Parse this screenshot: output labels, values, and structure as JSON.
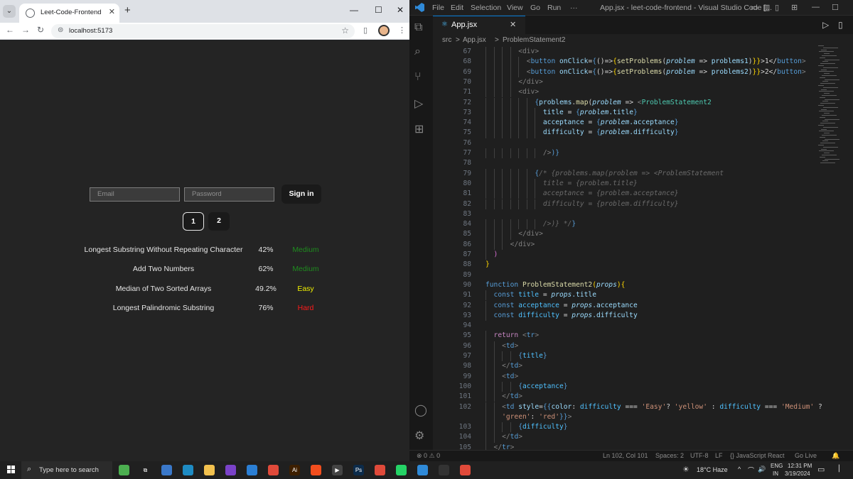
{
  "browser": {
    "tab_title": "Leet-Code-Frontend",
    "url": "localhost:5173",
    "new_tab": "+",
    "close_tab": "✕"
  },
  "webpage": {
    "email_placeholder": "Email",
    "password_placeholder": "Password",
    "signin_label": "Sign in",
    "page_buttons": [
      "1",
      "2"
    ],
    "problems": [
      {
        "title": "Longest Substring Without Repeating Character",
        "acceptance": "42%",
        "difficulty": "Medium",
        "color": "#1f8b1f"
      },
      {
        "title": "Add Two Numbers",
        "acceptance": "62%",
        "difficulty": "Medium",
        "color": "#1f8b1f"
      },
      {
        "title": "Median of Two Sorted Arrays",
        "acceptance": "49.2%",
        "difficulty": "Easy",
        "color": "#f0f000"
      },
      {
        "title": "Longest Palindromic Substring",
        "acceptance": "76%",
        "difficulty": "Hard",
        "color": "#ff1a1a"
      }
    ]
  },
  "vscode": {
    "menu": [
      "File",
      "Edit",
      "Selection",
      "View",
      "Go",
      "Run",
      "···"
    ],
    "window_title": "App.jsx - leet-code-frontend - Visual Studio Code [...",
    "tab_name": "App.jsx",
    "breadcrumb": [
      "src",
      ">",
      "App.jsx",
      ">",
      "ProblemStatement2"
    ],
    "status": {
      "problems": "⊗ 0 ⚠ 0",
      "cursor": "Ln 102, Col 101",
      "spaces": "Spaces: 2",
      "encoding": "UTF-8",
      "eol": "LF",
      "language": "{} JavaScript React",
      "golive": "Go Live"
    },
    "code_lines": [
      {
        "n": "67",
        "i": 4,
        "t": [
          [
            "<div>",
            "#808080"
          ]
        ]
      },
      {
        "n": "68",
        "i": 5,
        "t": [
          [
            "<",
            "#808080"
          ],
          [
            "button ",
            "#569cd6"
          ],
          [
            "onClick",
            "#9cdcfe"
          ],
          [
            "=",
            "#d4d4d4"
          ],
          [
            "{",
            "#569cd6"
          ],
          [
            "()=>",
            "#d4d4d4"
          ],
          [
            "{",
            "#ffd700"
          ],
          [
            "setProblems",
            "#dcdcaa"
          ],
          [
            "(",
            "#d4d4d4"
          ],
          [
            "problem",
            "#9cdcfe"
          ],
          [
            " => ",
            "#d4d4d4"
          ],
          [
            "problems1",
            "#9cdcfe"
          ],
          [
            ")",
            "#d4d4d4"
          ],
          [
            "}}",
            "#ffd700"
          ],
          [
            ">1</",
            "#d4d4d4"
          ],
          [
            "button",
            "#569cd6"
          ],
          [
            ">",
            "#808080"
          ]
        ]
      },
      {
        "n": "69",
        "i": 5,
        "t": [
          [
            "<",
            "#808080"
          ],
          [
            "button ",
            "#569cd6"
          ],
          [
            "onClick",
            "#9cdcfe"
          ],
          [
            "=",
            "#d4d4d4"
          ],
          [
            "{",
            "#569cd6"
          ],
          [
            "()=>",
            "#d4d4d4"
          ],
          [
            "{",
            "#ffd700"
          ],
          [
            "setProblems",
            "#dcdcaa"
          ],
          [
            "(",
            "#d4d4d4"
          ],
          [
            "problem",
            "#9cdcfe"
          ],
          [
            " => ",
            "#d4d4d4"
          ],
          [
            "problems2",
            "#9cdcfe"
          ],
          [
            ")",
            "#d4d4d4"
          ],
          [
            "}}",
            "#ffd700"
          ],
          [
            ">2</",
            "#d4d4d4"
          ],
          [
            "button",
            "#569cd6"
          ],
          [
            ">",
            "#808080"
          ]
        ]
      },
      {
        "n": "70",
        "i": 4,
        "t": [
          [
            "</div>",
            "#808080"
          ]
        ]
      },
      {
        "n": "71",
        "i": 4,
        "t": [
          [
            "<div>",
            "#808080"
          ]
        ]
      },
      {
        "n": "72",
        "i": 6,
        "t": [
          [
            "{",
            "#569cd6"
          ],
          [
            "problems",
            "#9cdcfe"
          ],
          [
            ".",
            "#d4d4d4"
          ],
          [
            "map",
            "#dcdcaa"
          ],
          [
            "(",
            "#d4d4d4"
          ],
          [
            "problem",
            "#9cdcfe"
          ],
          [
            " => ",
            "#d4d4d4"
          ],
          [
            "<",
            "#808080"
          ],
          [
            "ProblemStatement2",
            "#4ec9b0"
          ]
        ]
      },
      {
        "n": "73",
        "i": 7,
        "t": [
          [
            "title ",
            "#9cdcfe"
          ],
          [
            "= ",
            "#d4d4d4"
          ],
          [
            "{",
            "#569cd6"
          ],
          [
            "problem",
            "#9cdcfe"
          ],
          [
            ".title",
            "#9cdcfe"
          ],
          [
            "}",
            "#569cd6"
          ]
        ]
      },
      {
        "n": "74",
        "i": 7,
        "t": [
          [
            "acceptance ",
            "#9cdcfe"
          ],
          [
            "= ",
            "#d4d4d4"
          ],
          [
            "{",
            "#569cd6"
          ],
          [
            "problem",
            "#9cdcfe"
          ],
          [
            ".acceptance",
            "#9cdcfe"
          ],
          [
            "}",
            "#569cd6"
          ]
        ]
      },
      {
        "n": "75",
        "i": 7,
        "t": [
          [
            "difficulty ",
            "#9cdcfe"
          ],
          [
            "= ",
            "#d4d4d4"
          ],
          [
            "{",
            "#569cd6"
          ],
          [
            "problem",
            "#9cdcfe"
          ],
          [
            ".difficulty",
            "#9cdcfe"
          ],
          [
            "}",
            "#569cd6"
          ]
        ]
      },
      {
        "n": "76",
        "i": 0,
        "t": []
      },
      {
        "n": "77",
        "i": 7,
        "t": [
          [
            "/>",
            "#808080"
          ],
          [
            ")}",
            "#569cd6"
          ]
        ]
      },
      {
        "n": "78",
        "i": 0,
        "t": []
      },
      {
        "n": "79",
        "i": 6,
        "t": [
          [
            "{",
            "#569cd6"
          ],
          [
            "/* {problems.map(problem => <ProblemStatement",
            "#6a6a6a"
          ]
        ]
      },
      {
        "n": "80",
        "i": 7,
        "t": [
          [
            "title = {problem.title}",
            "#6a6a6a"
          ]
        ]
      },
      {
        "n": "81",
        "i": 7,
        "t": [
          [
            "acceptance = {problem.acceptance}",
            "#6a6a6a"
          ]
        ]
      },
      {
        "n": "82",
        "i": 7,
        "t": [
          [
            "difficulty = {problem.difficulty}",
            "#6a6a6a"
          ]
        ]
      },
      {
        "n": "83",
        "i": 0,
        "t": []
      },
      {
        "n": "84",
        "i": 7,
        "t": [
          [
            "/>)} */",
            "#6a6a6a"
          ],
          [
            "}",
            "#569cd6"
          ]
        ]
      },
      {
        "n": "85",
        "i": 4,
        "t": [
          [
            "</div>",
            "#808080"
          ]
        ]
      },
      {
        "n": "86",
        "i": 3,
        "t": [
          [
            "</div>",
            "#808080"
          ]
        ]
      },
      {
        "n": "87",
        "i": 1,
        "t": [
          [
            ")",
            "#da70d6"
          ]
        ]
      },
      {
        "n": "88",
        "i": 0,
        "t": [
          [
            "}",
            "#ffd700"
          ]
        ]
      },
      {
        "n": "89",
        "i": 0,
        "t": []
      },
      {
        "n": "90",
        "i": 0,
        "t": [
          [
            "function ",
            "#569cd6"
          ],
          [
            "ProblemStatement2",
            "#dcdcaa"
          ],
          [
            "(",
            "#ffd700"
          ],
          [
            "props",
            "#9cdcfe"
          ],
          [
            "){",
            "#ffd700"
          ]
        ]
      },
      {
        "n": "91",
        "i": 1,
        "t": [
          [
            "const ",
            "#569cd6"
          ],
          [
            "title",
            "#4fc1ff"
          ],
          [
            " = ",
            "#d4d4d4"
          ],
          [
            "props",
            "#9cdcfe"
          ],
          [
            ".title",
            "#9cdcfe"
          ]
        ]
      },
      {
        "n": "92",
        "i": 1,
        "t": [
          [
            "const ",
            "#569cd6"
          ],
          [
            "acceptance",
            "#4fc1ff"
          ],
          [
            " = ",
            "#d4d4d4"
          ],
          [
            "props",
            "#9cdcfe"
          ],
          [
            ".acceptance",
            "#9cdcfe"
          ]
        ]
      },
      {
        "n": "93",
        "i": 1,
        "t": [
          [
            "const ",
            "#569cd6"
          ],
          [
            "difficulty",
            "#4fc1ff"
          ],
          [
            " = ",
            "#d4d4d4"
          ],
          [
            "props",
            "#9cdcfe"
          ],
          [
            ".difficulty",
            "#9cdcfe"
          ]
        ]
      },
      {
        "n": "94",
        "i": 0,
        "t": []
      },
      {
        "n": "95",
        "i": 1,
        "t": [
          [
            "return ",
            "#c586c0"
          ],
          [
            "<",
            "#808080"
          ],
          [
            "tr",
            "#569cd6"
          ],
          [
            ">",
            "#808080"
          ]
        ]
      },
      {
        "n": "96",
        "i": 2,
        "t": [
          [
            "<",
            "#808080"
          ],
          [
            "td",
            "#569cd6"
          ],
          [
            ">",
            "#808080"
          ]
        ]
      },
      {
        "n": "97",
        "i": 4,
        "t": [
          [
            "{",
            "#569cd6"
          ],
          [
            "title",
            "#4fc1ff"
          ],
          [
            "}",
            "#569cd6"
          ]
        ]
      },
      {
        "n": "98",
        "i": 2,
        "t": [
          [
            "</",
            "#808080"
          ],
          [
            "td",
            "#569cd6"
          ],
          [
            ">",
            "#808080"
          ]
        ]
      },
      {
        "n": "99",
        "i": 2,
        "t": [
          [
            "<",
            "#808080"
          ],
          [
            "td",
            "#569cd6"
          ],
          [
            ">",
            "#808080"
          ]
        ]
      },
      {
        "n": "100",
        "i": 4,
        "t": [
          [
            "{",
            "#569cd6"
          ],
          [
            "acceptance",
            "#4fc1ff"
          ],
          [
            "}",
            "#569cd6"
          ]
        ]
      },
      {
        "n": "101",
        "i": 2,
        "t": [
          [
            "</",
            "#808080"
          ],
          [
            "td",
            "#569cd6"
          ],
          [
            ">",
            "#808080"
          ]
        ]
      },
      {
        "n": "102",
        "i": 2,
        "t": [
          [
            "<",
            "#808080"
          ],
          [
            "td ",
            "#569cd6"
          ],
          [
            "style",
            "#9cdcfe"
          ],
          [
            "=",
            "#d4d4d4"
          ],
          [
            "{{",
            "#569cd6"
          ],
          [
            "color",
            "#9cdcfe"
          ],
          [
            ": ",
            "#d4d4d4"
          ],
          [
            "difficulty",
            "#4fc1ff"
          ],
          [
            " === ",
            "#d4d4d4"
          ],
          [
            "'Easy'",
            "#ce9178"
          ],
          [
            "? ",
            "#d4d4d4"
          ],
          [
            "'yellow'",
            "#ce9178"
          ],
          [
            " : ",
            "#d4d4d4"
          ],
          [
            "difficulty",
            "#4fc1ff"
          ],
          [
            " === ",
            "#d4d4d4"
          ],
          [
            "'Medium'",
            "#ce9178"
          ],
          [
            " ?",
            "#d4d4d4"
          ]
        ]
      },
      {
        "n": "",
        "i": 2,
        "t": [
          [
            "'green'",
            "#ce9178"
          ],
          [
            ": ",
            "#d4d4d4"
          ],
          [
            "'red'",
            "#ce9178"
          ],
          [
            "}}",
            "#569cd6"
          ],
          [
            ">",
            "#808080"
          ]
        ]
      },
      {
        "n": "103",
        "i": 4,
        "t": [
          [
            "{",
            "#569cd6"
          ],
          [
            "difficulty",
            "#4fc1ff"
          ],
          [
            "}",
            "#569cd6"
          ]
        ]
      },
      {
        "n": "104",
        "i": 2,
        "t": [
          [
            "</",
            "#808080"
          ],
          [
            "td",
            "#569cd6"
          ],
          [
            ">",
            "#808080"
          ]
        ]
      },
      {
        "n": "105",
        "i": 1,
        "t": [
          [
            "</",
            "#808080"
          ],
          [
            "tr",
            "#569cd6"
          ],
          [
            ">",
            "#808080"
          ]
        ]
      }
    ]
  },
  "taskbar": {
    "search_placeholder": "Type here to search",
    "weather": "18°C  Haze",
    "lang": "ENG",
    "region": "IN",
    "time": "12:31 PM",
    "date": "3/19/2024",
    "apps": [
      {
        "name": "cortana-icon",
        "color": "#4caf50",
        "label": ""
      },
      {
        "name": "task-view-icon",
        "color": "#202020",
        "label": "⧉"
      },
      {
        "name": "store-icon",
        "color": "#3a78c9",
        "label": ""
      },
      {
        "name": "edge-icon",
        "color": "#1e8bc3",
        "label": ""
      },
      {
        "name": "explorer-icon",
        "color": "#f2c14e",
        "label": ""
      },
      {
        "name": "jetbrains-icon",
        "color": "#7a42c8",
        "label": ""
      },
      {
        "name": "mail-icon",
        "color": "#2b7fd4",
        "label": ""
      },
      {
        "name": "chrome-icon",
        "color": "#e04a3a",
        "label": ""
      },
      {
        "name": "illustrator-icon",
        "color": "#3d1f00",
        "label": "Ai"
      },
      {
        "name": "figma-icon",
        "color": "#f24e1e",
        "label": ""
      },
      {
        "name": "media-icon",
        "color": "#444",
        "label": "▶"
      },
      {
        "name": "photoshop-icon",
        "color": "#0c2b4a",
        "label": "Ps"
      },
      {
        "name": "chrome2-icon",
        "color": "#e04a3a",
        "label": ""
      },
      {
        "name": "whatsapp-icon",
        "color": "#25d366",
        "label": ""
      },
      {
        "name": "vscode-icon",
        "color": "#2f8ad8",
        "label": ""
      },
      {
        "name": "github-icon",
        "color": "#333",
        "label": ""
      },
      {
        "name": "chrome3-icon",
        "color": "#e04a3a",
        "label": ""
      }
    ]
  }
}
